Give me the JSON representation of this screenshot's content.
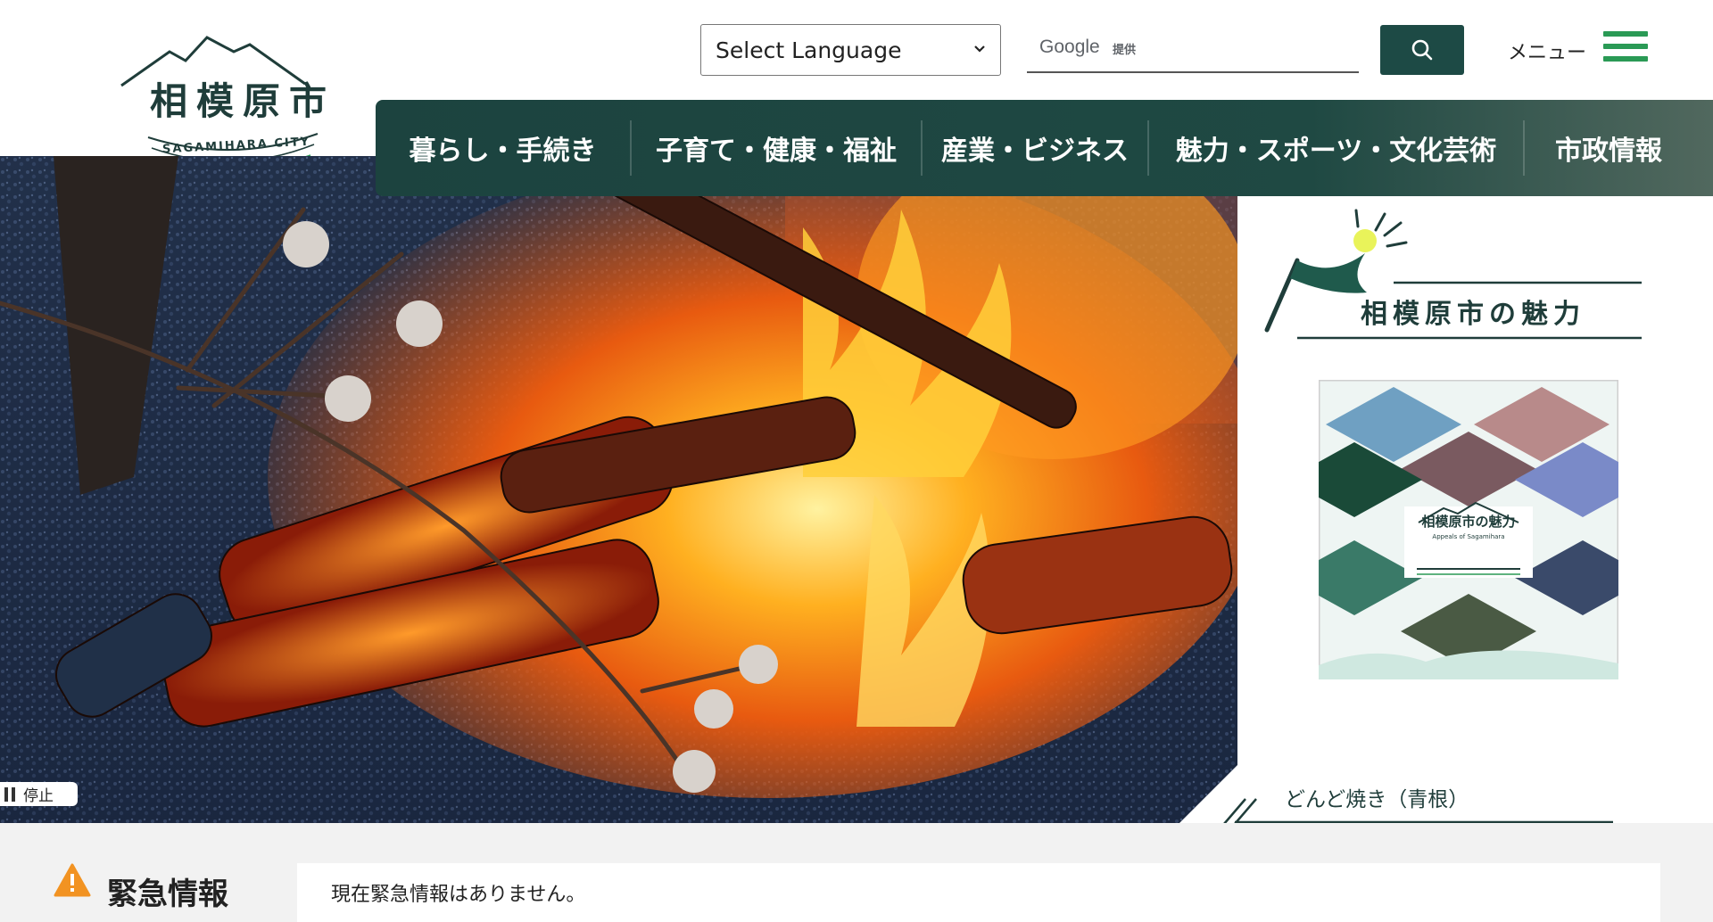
{
  "logo": {
    "kanji": "相模原市",
    "roman": "SAGAMIHARA CITY"
  },
  "header": {
    "language_select": "Select Language",
    "search_provider": "Google",
    "search_provider_suffix": "提供",
    "menu_label": "メニュー"
  },
  "nav": {
    "items": [
      "暮らし・手続き",
      "子育て・健康・福祉",
      "産業・ビジネス",
      "魅力・スポーツ・文化芸術",
      "市政情報"
    ]
  },
  "hero": {
    "pause_label": "停止",
    "caption": "どんど焼き（青根）"
  },
  "side": {
    "title": "相模原市の魅力",
    "thumb_title": "相模原市の魅力",
    "thumb_subtitle": "Appeals of Sagamihara"
  },
  "emergency": {
    "title": "緊急情報",
    "message": "現在緊急情報はありません。"
  },
  "colors": {
    "brand_dark": "#1d4a45",
    "menu_green": "#2a9a55",
    "warning": "#f29322"
  }
}
